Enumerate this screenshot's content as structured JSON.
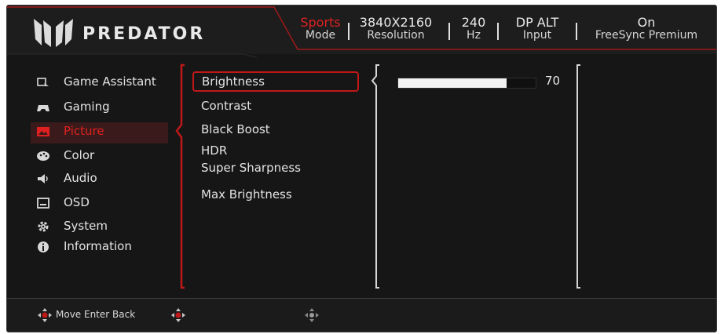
{
  "brand": {
    "name": "PREDATOR"
  },
  "header": {
    "status": [
      {
        "value": "Sports",
        "label": "Mode",
        "active": true
      },
      {
        "value": "3840X2160",
        "label": "Resolution"
      },
      {
        "value": "240",
        "label": "Hz"
      },
      {
        "value": "DP ALT",
        "label": "Input"
      },
      {
        "value": "On",
        "label": "FreeSync Premium"
      }
    ]
  },
  "nav": {
    "items": [
      {
        "label": "Game Assistant",
        "icon": "game-assistant-icon"
      },
      {
        "label": "Gaming",
        "icon": "gamepad-icon"
      },
      {
        "label": "Picture",
        "icon": "picture-icon",
        "selected": true
      },
      {
        "label": "Color",
        "icon": "palette-icon"
      },
      {
        "label": "Audio",
        "icon": "speaker-icon"
      },
      {
        "label": "OSD",
        "icon": "osd-icon"
      },
      {
        "label": "System",
        "icon": "gear-icon"
      },
      {
        "label": "Information",
        "icon": "info-icon"
      }
    ]
  },
  "picture_menu": {
    "items": [
      {
        "label": "Brightness",
        "selected": true
      },
      {
        "label": "Contrast"
      },
      {
        "label": "Black Boost"
      },
      {
        "label": "HDR"
      },
      {
        "label": "Super Sharpness"
      },
      {
        "label": "Max Brightness"
      }
    ]
  },
  "brightness": {
    "value": "70",
    "level_percent": 79
  },
  "footer": {
    "hint": "Move Enter Back"
  },
  "colors": {
    "accent": "#e02020",
    "background": "#161616",
    "text": "#e3e3e3"
  }
}
